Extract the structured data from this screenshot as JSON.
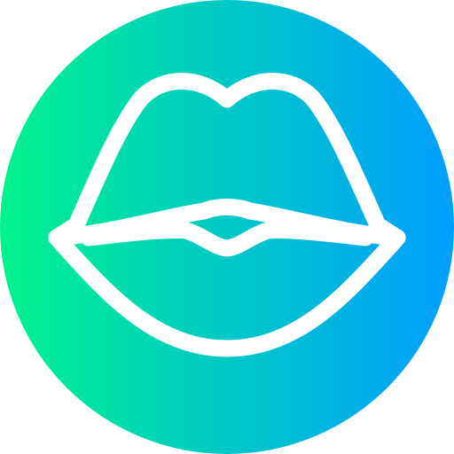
{
  "icon": {
    "name": "lips-icon",
    "gradient_start": "#00F38D",
    "gradient_end": "#009EFF",
    "stroke_color": "#FFFFFF"
  }
}
